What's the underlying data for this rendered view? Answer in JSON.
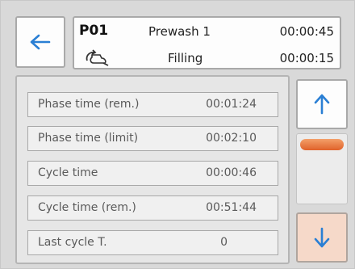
{
  "header": {
    "program_code": "P01",
    "phase_name": "Prewash 1",
    "phase_elapsed": "00:00:45",
    "status_text": "Filling",
    "status_elapsed": "00:00:15"
  },
  "rows": [
    {
      "label": "Phase time (rem.)",
      "value": "00:01:24"
    },
    {
      "label": "Phase time (limit)",
      "value": "00:02:10"
    },
    {
      "label": "Cycle time",
      "value": "00:00:46"
    },
    {
      "label": "Cycle time (rem.)",
      "value": "00:51:44"
    },
    {
      "label": "Last cycle T.",
      "value": "0"
    }
  ],
  "icons": {
    "back": "arrow-left-icon",
    "status": "filling-wash-icon",
    "scroll_up": "arrow-up-icon",
    "scroll_down": "arrow-down-icon"
  },
  "colors": {
    "accent_blue": "#2a7fd4",
    "scroll_thumb": "#e8723a",
    "scroll_down_bg": "#f6d9c9"
  }
}
